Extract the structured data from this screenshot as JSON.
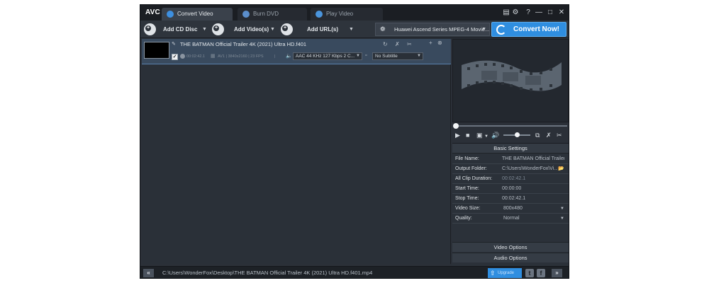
{
  "app": {
    "logo": "AVC",
    "tabs": [
      {
        "label": "Convert Video"
      },
      {
        "label": "Burn DVD"
      },
      {
        "label": "Play Video"
      }
    ]
  },
  "toolbar": {
    "add_cd": "Add CD Disc",
    "add_videos": "Add Video(s)",
    "add_urls": "Add URL(s)",
    "profile": "Huawei Ascend Series MPEG-4 Movie...",
    "convert": "Convert Now!"
  },
  "file": {
    "name": "THE BATMAN Official Trailer 4K (2021) Ultra HD.f401",
    "duration": "00:02:42.1",
    "video_info": "AV1 | 3840x2160 | 23 FPS",
    "audio": "AAC 44 KHz 127 Kbps 2 C...",
    "subtitle": "No Subtitle"
  },
  "settings": {
    "header": "Basic Settings",
    "rows": [
      {
        "k": "File Name:",
        "v": "THE BATMAN Official Trailer..."
      },
      {
        "k": "Output Folder:",
        "v": "C:\\Users\\WonderFox\\Vi..."
      },
      {
        "k": "All Clip Duration:",
        "v": "00:02:42.1"
      },
      {
        "k": "Start Time:",
        "v": "00:00:00"
      },
      {
        "k": "Stop Time:",
        "v": "00:02:42.1"
      },
      {
        "k": "Video Size:",
        "v": "800x480"
      },
      {
        "k": "Quality:",
        "v": "Normal"
      }
    ],
    "video_options": "Video Options",
    "audio_options": "Audio Options"
  },
  "bottom": {
    "output_path": "C:\\Users\\WonderFox\\Desktop\\THE BATMAN Official Trailer 4K (2021) Ultra HD.f401.mp4",
    "upgrade": "Upgrade"
  },
  "player": {
    "seek_position": 0,
    "volume": 0.5
  },
  "colors": {
    "accent": "#2f8ee0",
    "selected_row": "#394a5e",
    "background": "#2b3038"
  }
}
